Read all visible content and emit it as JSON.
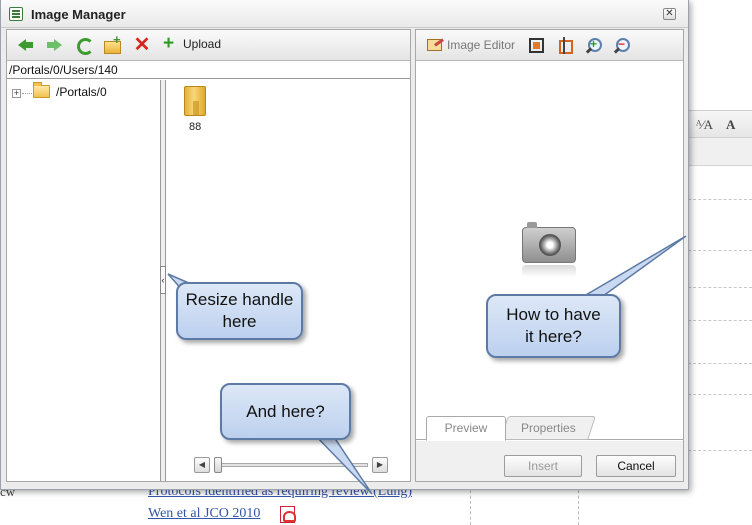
{
  "dialog": {
    "title": "Image Manager",
    "close_glyph": "✕"
  },
  "toolbar": {
    "upload_label": "Upload",
    "icons": [
      "back-arrow-icon",
      "forward-arrow-icon",
      "refresh-icon",
      "new-folder-icon",
      "delete-icon",
      "upload-plus-icon"
    ]
  },
  "path": "/Portals/0/Users/140",
  "tree": {
    "expander": "+",
    "root_label": "/Portals/0"
  },
  "files": [
    {
      "name": "88",
      "icon": "folder-icon"
    }
  ],
  "splitter": {
    "grip_glyph": "‹"
  },
  "slider": {
    "left_glyph": "◀",
    "right_glyph": "▶"
  },
  "right_toolbar": {
    "image_editor_label": "Image Editor",
    "icons": [
      "image-editor-icon",
      "crop-icon",
      "best-fit-icon",
      "zoom-in-icon",
      "zoom-out-icon"
    ]
  },
  "tabs": {
    "preview": "Preview",
    "properties": "Properties"
  },
  "buttons": {
    "insert": "Insert",
    "cancel": "Cancel"
  },
  "callouts": {
    "resize_line1": "Resize handle",
    "resize_line2": "here",
    "howto_line1": "How to have",
    "howto_line2": "it here?",
    "andhere": "And here?"
  },
  "background": {
    "link1": "Protocols identified as requiring review (Lung)",
    "link2": "Wen et al JCO 2010",
    "cw_text": "cw",
    "tool1": "ᴬ⁄A",
    "tool2": "A"
  },
  "colors": {
    "callout_fill": "#c9d9f1",
    "callout_border": "#5d7aa4",
    "accent_green": "#3d9a2f",
    "delete_red": "#d9261c"
  }
}
